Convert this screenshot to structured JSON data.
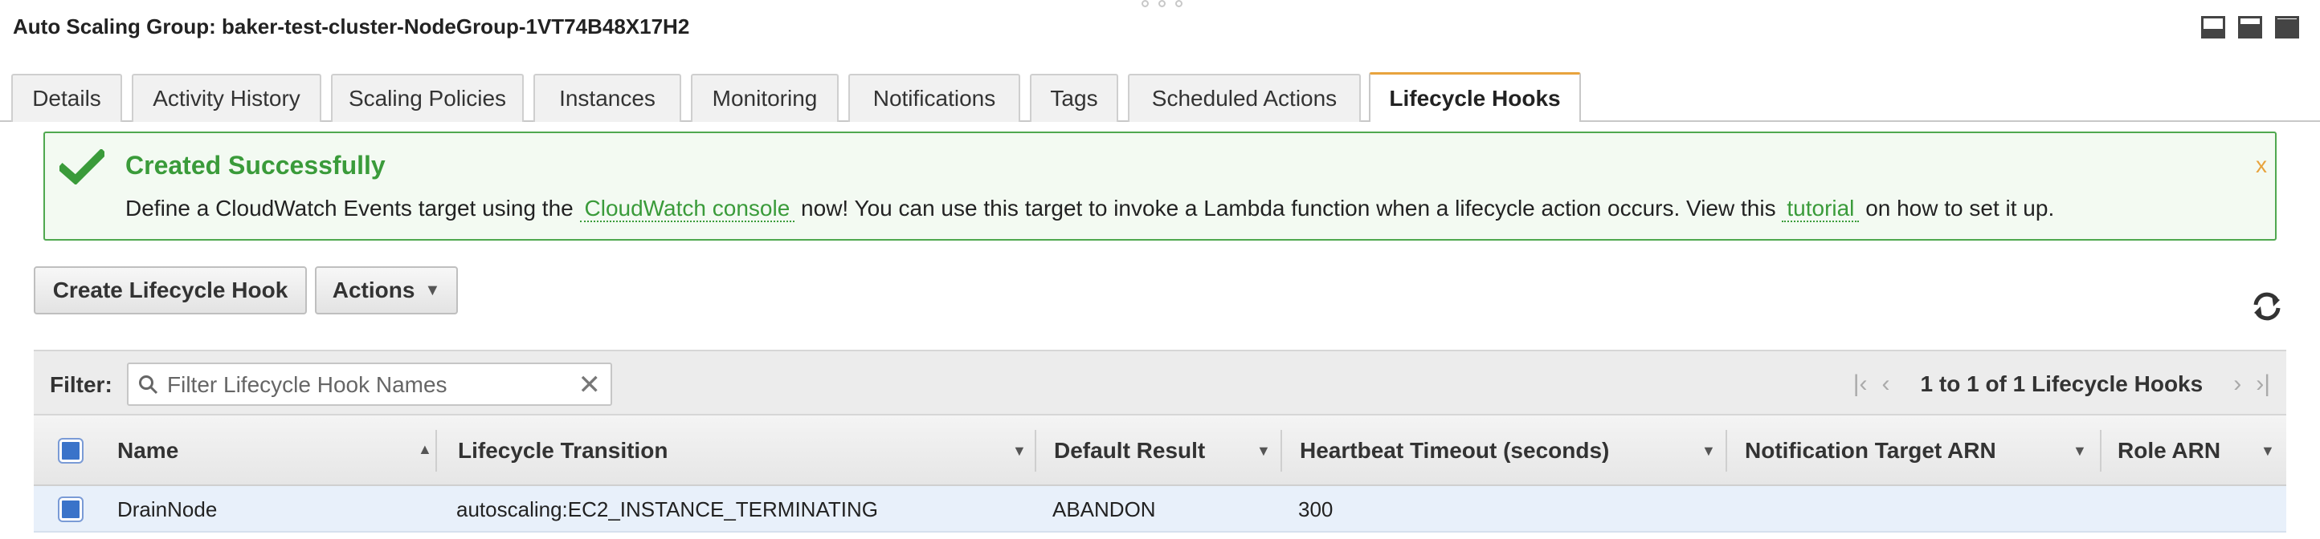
{
  "window": {
    "title": "Auto Scaling Group: baker-test-cluster-NodeGroup-1VT74B48X17H2"
  },
  "tabs": [
    {
      "label": "Details"
    },
    {
      "label": "Activity History"
    },
    {
      "label": "Scaling Policies"
    },
    {
      "label": "Instances"
    },
    {
      "label": "Monitoring"
    },
    {
      "label": "Notifications"
    },
    {
      "label": "Tags"
    },
    {
      "label": "Scheduled Actions"
    },
    {
      "label": "Lifecycle Hooks"
    }
  ],
  "active_tab": "Lifecycle Hooks",
  "alert": {
    "heading": "Created Successfully",
    "text_before": "Define a CloudWatch Events target using the",
    "link1": "CloudWatch console",
    "text_middle": "now! You can use this target to invoke a Lambda function when a lifecycle action occurs. View this",
    "link2": "tutorial",
    "text_after": "on how to set it up.",
    "close": "x"
  },
  "toolbar": {
    "create_label": "Create Lifecycle Hook",
    "actions_label": "Actions"
  },
  "filter": {
    "label": "Filter:",
    "placeholder": "Filter Lifecycle Hook Names",
    "pagination": "1 to 1 of 1 Lifecycle Hooks"
  },
  "table": {
    "columns": [
      "Name",
      "Lifecycle Transition",
      "Default Result",
      "Heartbeat Timeout (seconds)",
      "Notification Target ARN",
      "Role ARN"
    ],
    "rows": [
      {
        "name": "DrainNode",
        "lifecycle_transition": "autoscaling:EC2_INSTANCE_TERMINATING",
        "default_result": "ABANDON",
        "heartbeat_timeout": "300",
        "notification_target_arn": "",
        "role_arn": ""
      }
    ]
  },
  "colors": {
    "accent_tab": "#e8a33d",
    "success": "#3a9b3a",
    "checkbox": "#3a73c9"
  }
}
